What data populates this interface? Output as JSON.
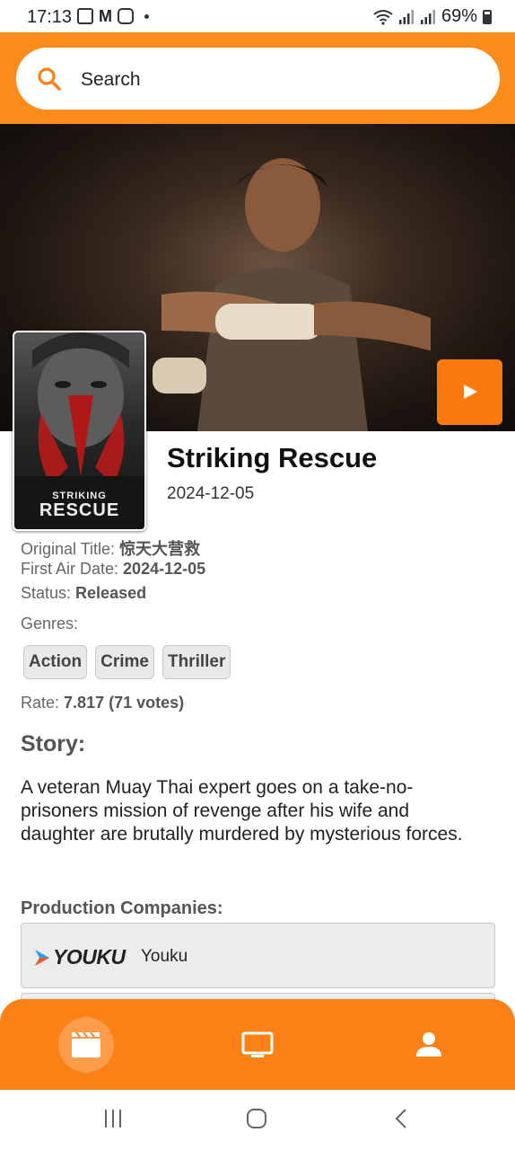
{
  "status_bar": {
    "time": "17:13",
    "battery": "69%"
  },
  "search": {
    "placeholder": "Search"
  },
  "movie": {
    "title": "Striking Rescue",
    "date": "2024-12-05",
    "poster_logo_line1": "STRIKING",
    "poster_logo_line2": "RESCUE",
    "original_title_label": "Original Title:",
    "original_title": "惊天大营救",
    "first_air_label": "First Air Date:",
    "first_air_date": "2024-12-05",
    "status_label": "Status:",
    "status": "Released",
    "genres_label": "Genres:",
    "genres": [
      "Action",
      "Crime",
      "Thriller"
    ],
    "rate_label": "Rate:",
    "rate": "7.817 (71 votes)",
    "story_heading": "Story:",
    "story": "A veteran Muay Thai expert goes on a take-no-prisoners mission of revenge after his wife and daughter are brutally murdered by mysterious forces.",
    "production_heading": "Production Companies:",
    "companies": [
      {
        "logo_text": "YOUKU",
        "name": "Youku"
      }
    ]
  },
  "bottom_nav": {
    "items": [
      "movies-icon",
      "tv-icon",
      "profile-icon"
    ],
    "active": "movies-icon"
  },
  "colors": {
    "accent": "#fb8c1c",
    "play": "#fb7a10"
  }
}
